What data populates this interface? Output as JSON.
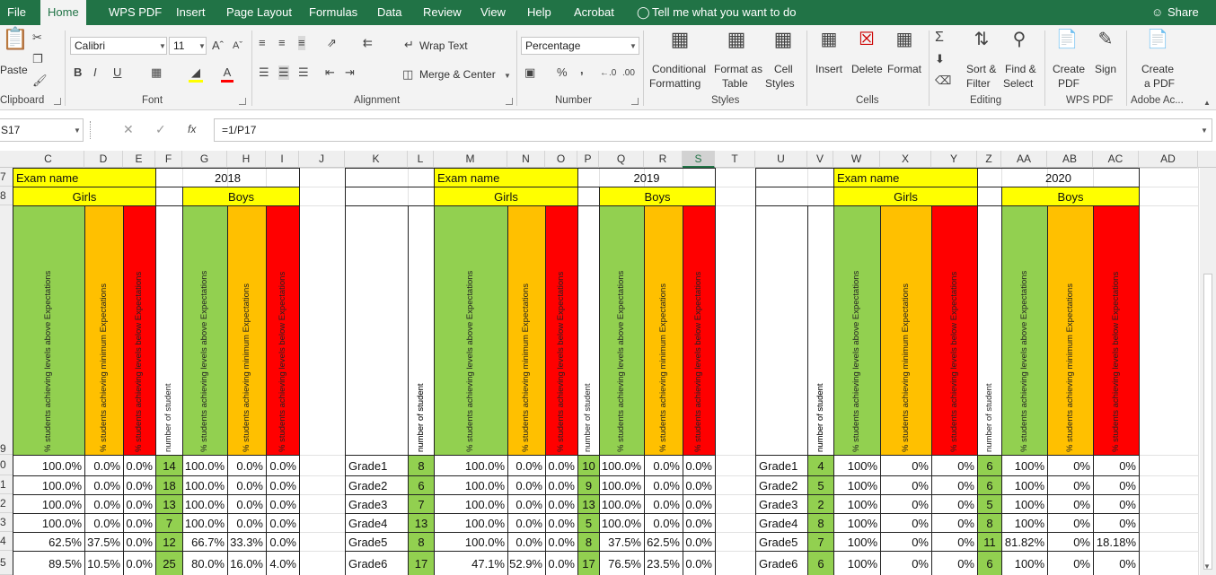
{
  "menu": {
    "items": [
      "File",
      "Home",
      "WPS PDF",
      "Insert",
      "Page Layout",
      "Formulas",
      "Data",
      "Review",
      "View",
      "Help",
      "Acrobat"
    ],
    "tell_me": "Tell me what you want to do",
    "share": "Share"
  },
  "ribbon": {
    "clipboard": {
      "paste": "Paste",
      "group": "Clipboard"
    },
    "font": {
      "name": "Calibri",
      "size": "11",
      "group": "Font",
      "bold": "B",
      "italic": "I",
      "underline": "U"
    },
    "alignment": {
      "wrap": "Wrap Text",
      "merge": "Merge & Center",
      "group": "Alignment"
    },
    "number": {
      "format": "Percentage",
      "group": "Number",
      "percent": "%",
      "comma": ","
    },
    "styles": {
      "conditional_1": "Conditional",
      "conditional_2": "Formatting",
      "format_table_1": "Format as",
      "format_table_2": "Table",
      "cell_styles_1": "Cell",
      "cell_styles_2": "Styles",
      "group": "Styles"
    },
    "cells": {
      "insert": "Insert",
      "delete": "Delete",
      "format": "Format",
      "group": "Cells"
    },
    "editing": {
      "sort_1": "Sort &",
      "sort_2": "Filter",
      "find_1": "Find &",
      "find_2": "Select",
      "group": "Editing"
    },
    "wpspdf": {
      "create_1": "Create",
      "create_2": "PDF",
      "sign": "Sign",
      "group": "WPS PDF"
    },
    "adobe": {
      "create_1": "Create",
      "create_2": "a PDF",
      "group": "Adobe Ac..."
    }
  },
  "formula_bar": {
    "name_box": "S17",
    "formula": "=1/P17",
    "fx": "fx"
  },
  "grid": {
    "columns": [
      "C",
      "D",
      "E",
      "F",
      "G",
      "H",
      "I",
      "J",
      "K",
      "L",
      "M",
      "N",
      "O",
      "P",
      "Q",
      "R",
      "S",
      "T",
      "U",
      "V",
      "W",
      "X",
      "Y",
      "Z",
      "AA",
      "AB",
      "AC",
      "AD"
    ],
    "selected_column": "S",
    "row_numbers": [
      "7",
      "8",
      "9",
      "0",
      "1",
      "2",
      "3",
      "4",
      "5"
    ],
    "labels": {
      "exam_name": "Exam name",
      "girls": "Girls",
      "boys": "Boys",
      "year_2018": "2018",
      "year_2019": "2019",
      "year_2020": "2020",
      "above": "% students achieving levels above Expectations",
      "minimum": "% students achieving minimum Expectations",
      "below": "% students achieving levels below Expectations",
      "number": "number of student"
    },
    "table_2018": [
      [
        "100.0%",
        "0.0%",
        "0.0%",
        "14",
        "100.0%",
        "0.0%",
        "0.0%"
      ],
      [
        "100.0%",
        "0.0%",
        "0.0%",
        "18",
        "100.0%",
        "0.0%",
        "0.0%"
      ],
      [
        "100.0%",
        "0.0%",
        "0.0%",
        "13",
        "100.0%",
        "0.0%",
        "0.0%"
      ],
      [
        "100.0%",
        "0.0%",
        "0.0%",
        "7",
        "100.0%",
        "0.0%",
        "0.0%"
      ],
      [
        "62.5%",
        "37.5%",
        "0.0%",
        "12",
        "66.7%",
        "33.3%",
        "0.0%"
      ],
      [
        "89.5%",
        "10.5%",
        "0.0%",
        "25",
        "80.0%",
        "16.0%",
        "4.0%"
      ]
    ],
    "table_2019": [
      [
        "Grade1",
        "8",
        "100.0%",
        "0.0%",
        "0.0%",
        "10",
        "100.0%",
        "0.0%",
        "0.0%"
      ],
      [
        "Grade2",
        "6",
        "100.0%",
        "0.0%",
        "0.0%",
        "9",
        "100.0%",
        "0.0%",
        "0.0%"
      ],
      [
        "Grade3",
        "7",
        "100.0%",
        "0.0%",
        "0.0%",
        "13",
        "100.0%",
        "0.0%",
        "0.0%"
      ],
      [
        "Grade4",
        "13",
        "100.0%",
        "0.0%",
        "0.0%",
        "5",
        "100.0%",
        "0.0%",
        "0.0%"
      ],
      [
        "Grade5",
        "8",
        "100.0%",
        "0.0%",
        "0.0%",
        "8",
        "37.5%",
        "62.5%",
        "0.0%"
      ],
      [
        "Grade6",
        "17",
        "47.1%",
        "52.9%",
        "0.0%",
        "17",
        "76.5%",
        "23.5%",
        "0.0%"
      ]
    ],
    "table_2020": [
      [
        "Grade1",
        "4",
        "100%",
        "0%",
        "0%",
        "6",
        "100%",
        "0%",
        "0%"
      ],
      [
        "Grade2",
        "5",
        "100%",
        "0%",
        "0%",
        "6",
        "100%",
        "0%",
        "0%"
      ],
      [
        "Grade3",
        "2",
        "100%",
        "0%",
        "0%",
        "5",
        "100%",
        "0%",
        "0%"
      ],
      [
        "Grade4",
        "8",
        "100%",
        "0%",
        "0%",
        "8",
        "100%",
        "0%",
        "0%"
      ],
      [
        "Grade5",
        "7",
        "100%",
        "0%",
        "0%",
        "11",
        "81.82%",
        "0%",
        "18.18%"
      ],
      [
        "Grade6",
        "6",
        "100%",
        "0%",
        "0%",
        "6",
        "100%",
        "0%",
        "0%"
      ]
    ]
  },
  "colors": {
    "excel_green": "#217346",
    "yellow": "#ffff00",
    "green": "#92d050",
    "orange": "#ffc000",
    "red": "#ff0000"
  }
}
